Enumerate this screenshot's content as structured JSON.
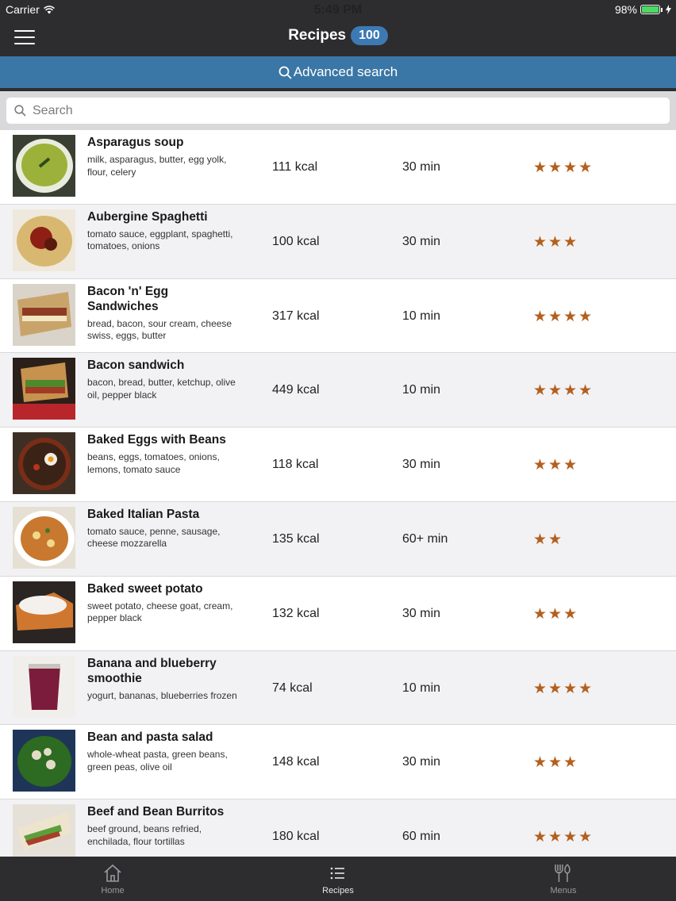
{
  "status_bar": {
    "carrier": "Carrier",
    "time": "5:49 PM",
    "battery": "98%",
    "battery_level": 0.98
  },
  "nav": {
    "title": "Recipes",
    "count": "100"
  },
  "advanced_search": {
    "label": "Advanced search"
  },
  "search": {
    "placeholder": "Search"
  },
  "colors": {
    "accent": "#3a76a6",
    "badge": "#3d7ab4",
    "star": "#b45f1c",
    "bar": "#2d2d2f"
  },
  "recipes": [
    {
      "name": "Asparagus soup",
      "ingredients": "milk, asparagus, butter, egg yolk, flour, celery",
      "kcal": "111 kcal",
      "time": "30 min",
      "stars": 4,
      "image": "asparagus-soup-image"
    },
    {
      "name": "Aubergine Spaghetti",
      "ingredients": "tomato sauce, eggplant, spaghetti, tomatoes, onions",
      "kcal": "100 kcal",
      "time": "30 min",
      "stars": 3,
      "image": "aubergine-spaghetti-image"
    },
    {
      "name": "Bacon 'n' Egg Sandwiches",
      "ingredients": "bread, bacon, sour cream, cheese swiss, eggs, butter",
      "kcal": "317 kcal",
      "time": "10 min",
      "stars": 4,
      "image": "bacon-egg-sandwich-image"
    },
    {
      "name": "Bacon sandwich",
      "ingredients": "bacon, bread, butter, ketchup, olive oil, pepper black",
      "kcal": "449 kcal",
      "time": "10 min",
      "stars": 4,
      "image": "bacon-sandwich-image"
    },
    {
      "name": "Baked Eggs with Beans",
      "ingredients": "beans, eggs, tomatoes, onions, lemons, tomato sauce",
      "kcal": "118 kcal",
      "time": "30 min",
      "stars": 3,
      "image": "baked-eggs-image"
    },
    {
      "name": "Baked Italian Pasta",
      "ingredients": "tomato sauce, penne, sausage, cheese mozzarella",
      "kcal": "135 kcal",
      "time": "60+ min",
      "stars": 2,
      "image": "baked-pasta-image"
    },
    {
      "name": "Baked sweet potato",
      "ingredients": "sweet potato, cheese goat, cream, pepper black",
      "kcal": "132 kcal",
      "time": "30 min",
      "stars": 3,
      "image": "sweet-potato-image"
    },
    {
      "name": "Banana and blueberry smoothie",
      "ingredients": "yogurt, bananas, blueberries frozen",
      "kcal": "74 kcal",
      "time": "10 min",
      "stars": 4,
      "image": "smoothie-image"
    },
    {
      "name": "Bean and pasta salad",
      "ingredients": "whole-wheat pasta, green beans, green peas, olive oil",
      "kcal": "148 kcal",
      "time": "30 min",
      "stars": 3,
      "image": "pasta-salad-image"
    },
    {
      "name": "Beef and Bean Burritos",
      "ingredients": "beef ground, beans refried, enchilada, flour tortillas",
      "kcal": "180 kcal",
      "time": "60 min",
      "stars": 4,
      "image": "burritos-image"
    }
  ],
  "tabs": [
    {
      "label": "Home",
      "icon": "home-icon",
      "active": false
    },
    {
      "label": "Recipes",
      "icon": "list-icon",
      "active": true
    },
    {
      "label": "Menus",
      "icon": "cutlery-icon",
      "active": false
    }
  ]
}
